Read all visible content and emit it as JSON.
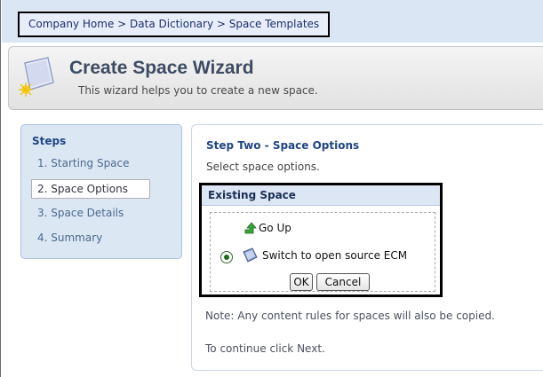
{
  "breadcrumb": {
    "items": [
      "Company Home",
      "Data Dictionary",
      "Space Templates"
    ],
    "separator": ">"
  },
  "wizard": {
    "title": "Create Space Wizard",
    "subtitle": "This wizard helps you to create a new space.",
    "icon": "wizard-wand-icon"
  },
  "steps": {
    "title": "Steps",
    "items": [
      {
        "label": "1. Starting Space"
      },
      {
        "label": "2. Space Options"
      },
      {
        "label": "3. Space Details"
      },
      {
        "label": "4. Summary"
      }
    ],
    "active_index": 1
  },
  "main": {
    "title": "Step Two - Space Options",
    "subtitle": "Select space options.",
    "existing_space": {
      "header": "Existing Space",
      "go_up_label": "Go Up",
      "go_up_icon": "up-arrow-icon",
      "selected_space_label": "Switch to open source ECM",
      "space_icon": "space-folder-icon",
      "ok_label": "OK",
      "cancel_label": "Cancel"
    },
    "note": "Note: Any content rules for spaces will also be copied.",
    "continue_text": "To continue click Next."
  },
  "colors": {
    "accent": "#1f4683",
    "breadcrumb_bg": "#dbe6f5",
    "steps_bg": "#dce7f4",
    "radio_selected": "#1b6b1b"
  }
}
